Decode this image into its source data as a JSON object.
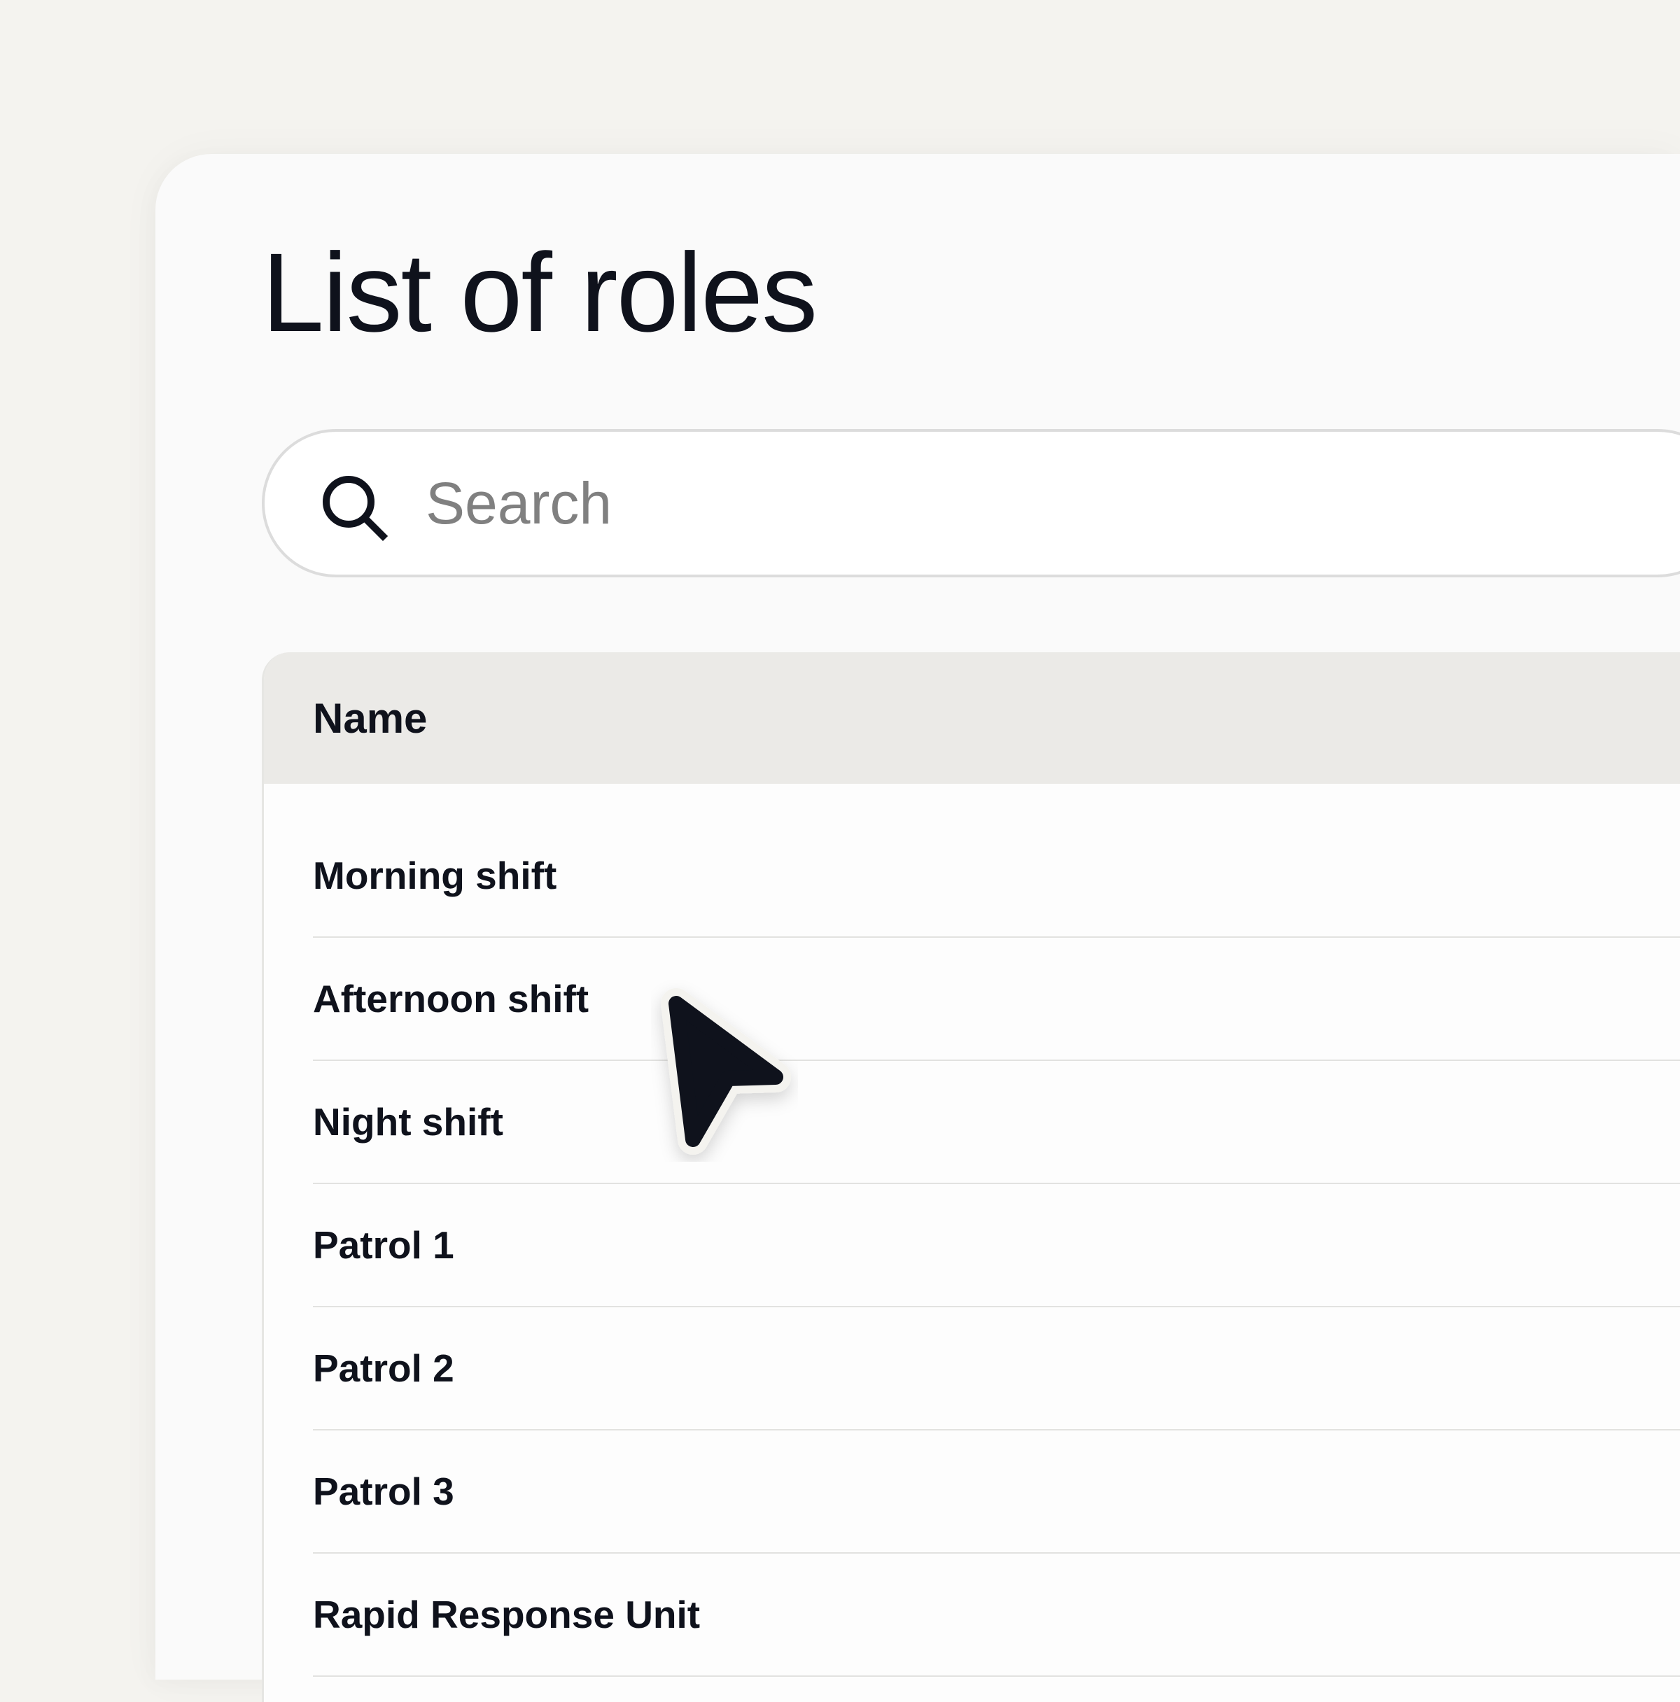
{
  "page": {
    "title": "List of roles"
  },
  "search": {
    "placeholder": "Search",
    "value": ""
  },
  "table": {
    "columns": [
      "Name"
    ],
    "rows": [
      {
        "name": "Morning shift"
      },
      {
        "name": "Afternoon shift"
      },
      {
        "name": "Night shift"
      },
      {
        "name": "Patrol 1"
      },
      {
        "name": "Patrol 2"
      },
      {
        "name": "Patrol 3"
      },
      {
        "name": "Rapid Response Unit"
      }
    ]
  },
  "icons": {
    "search": "search-icon",
    "cursor": "mouse-pointer-icon"
  },
  "colors": {
    "background": "#f4f3ef",
    "panel": "#fafafa",
    "text": "#0f121c",
    "placeholder": "#808080",
    "header_bg": "#ebeae7",
    "divider": "#e2e2e0"
  }
}
